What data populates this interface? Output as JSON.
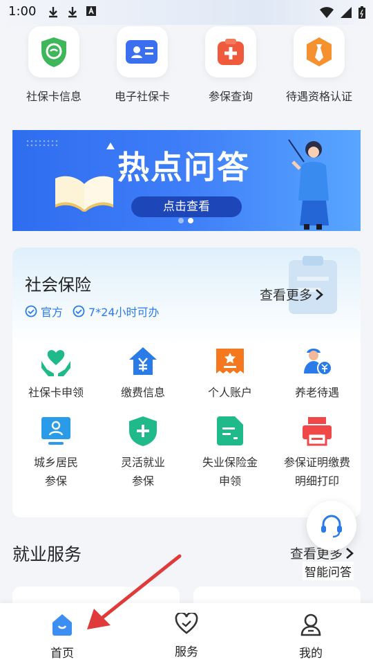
{
  "status_bar": {
    "time": "1:00",
    "icons": [
      "download-icon",
      "download-icon",
      "font-icon",
      "wifi-icon",
      "signal-icon",
      "battery-icon"
    ]
  },
  "quick_services": [
    {
      "label": "社保卡信息",
      "icon": "social-card-shield-icon",
      "color": "#3fb65a"
    },
    {
      "label": "电子社保卡",
      "icon": "id-card-icon",
      "color": "#3c6ff0"
    },
    {
      "label": "参保查询",
      "icon": "medical-plus-icon",
      "color": "#f05a3c"
    },
    {
      "label": "待遇资格认证",
      "icon": "tie-badge-icon",
      "color": "#f5912e"
    }
  ],
  "banner": {
    "title": "热点问答",
    "button": "点击查看",
    "dots": 2,
    "active_dot": 1
  },
  "social_insurance": {
    "title": "社会保险",
    "tags": [
      "官方",
      "7*24小时可办"
    ],
    "more": "查看更多",
    "items": [
      {
        "label": "社保卡申领",
        "icon": "hands-heart-icon",
        "color": "#1fb98a"
      },
      {
        "label": "缴费信息",
        "icon": "yuan-house-icon",
        "color": "#2a7be8"
      },
      {
        "label": "个人账户",
        "icon": "account-ticket-icon",
        "color": "#f5781f"
      },
      {
        "label": "养老待遇",
        "icon": "elder-yuan-icon",
        "color": "#2a7be8"
      },
      {
        "label": "城乡居民\n参保",
        "icon": "monitor-user-icon",
        "color": "#2a9be8"
      },
      {
        "label": "灵活就业\n参保",
        "icon": "shield-plus-icon",
        "color": "#1fb98a"
      },
      {
        "label": "失业保险金\n申领",
        "icon": "document-icon",
        "color": "#1fb98a"
      },
      {
        "label": "参保证明缴费\n明细打印",
        "icon": "printer-icon",
        "color": "#f04848"
      }
    ]
  },
  "floating_assistant": {
    "label": "智能问答",
    "icon": "headset-icon"
  },
  "employment": {
    "title": "就业服务",
    "more": "查看更多"
  },
  "tab_bar": [
    {
      "label": "首页",
      "icon": "home-icon",
      "active": true
    },
    {
      "label": "服务",
      "icon": "heart-service-icon",
      "active": false
    },
    {
      "label": "我的",
      "icon": "user-icon",
      "active": false
    }
  ],
  "colors": {
    "primary": "#2a7be8",
    "annotation": "#e03b3b"
  }
}
